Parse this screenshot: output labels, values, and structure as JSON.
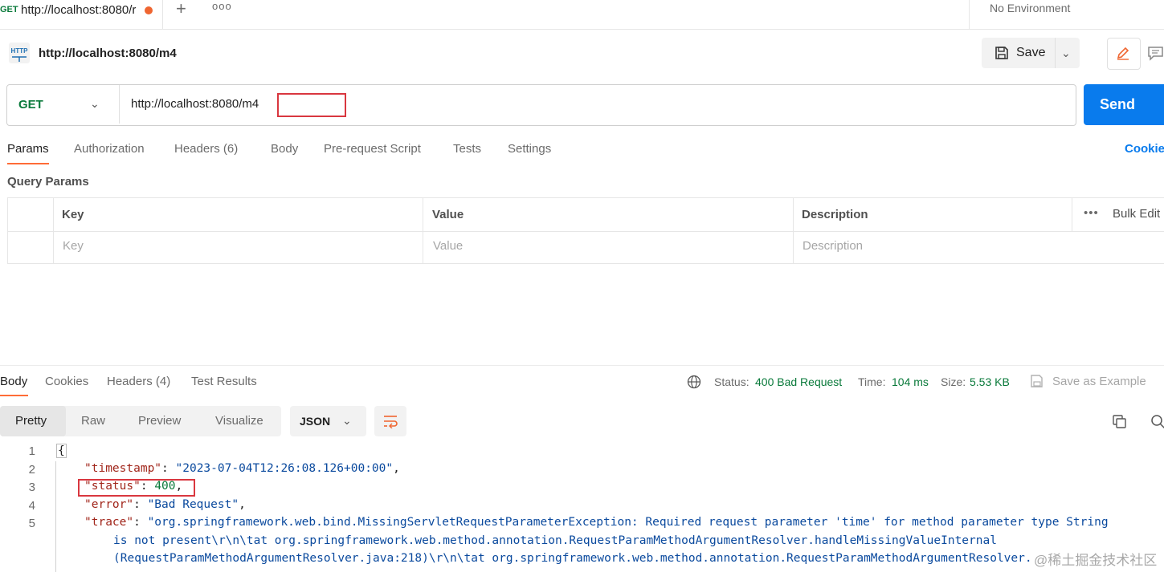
{
  "top_tab": {
    "method": "GET",
    "url": "http://localhost:8080/r",
    "more_icon": "more-horizontal-icon",
    "add_icon": "plus-icon"
  },
  "environment": {
    "label": "No Environment"
  },
  "request": {
    "title": "http://localhost:8080/m4",
    "save_label": "Save",
    "method": "GET",
    "url": "http://localhost:8080/m4",
    "send_label": "Send"
  },
  "request_tabs": [
    {
      "label": "Params"
    },
    {
      "label": "Authorization"
    },
    {
      "label": "Headers (6)"
    },
    {
      "label": "Body"
    },
    {
      "label": "Pre-request Script"
    },
    {
      "label": "Tests"
    },
    {
      "label": "Settings"
    }
  ],
  "cookies_link": "Cookie",
  "query_params": {
    "title": "Query Params",
    "headers": {
      "key": "Key",
      "value": "Value",
      "description": "Description",
      "bulk_edit": "Bulk Edit",
      "more": "•••"
    },
    "placeholders": {
      "key": "Key",
      "value": "Value",
      "description": "Description"
    }
  },
  "response_tabs": [
    {
      "label": "Body"
    },
    {
      "label": "Cookies"
    },
    {
      "label": "Headers (4)"
    },
    {
      "label": "Test Results"
    }
  ],
  "response_meta": {
    "status_label": "Status:",
    "status_value": "400 Bad Request",
    "time_label": "Time:",
    "time_value": "104 ms",
    "size_label": "Size:",
    "size_value": "5.53 KB",
    "save_example": "Save as Example"
  },
  "view_modes": [
    {
      "label": "Pretty"
    },
    {
      "label": "Raw"
    },
    {
      "label": "Preview"
    },
    {
      "label": "Visualize"
    }
  ],
  "format": "JSON",
  "code": {
    "line_numbers": [
      "1",
      "2",
      "3",
      "4",
      "5"
    ],
    "open_brace": "{",
    "timestamp_key": "\"timestamp\"",
    "timestamp_val": "\"2023-07-04T12:26:08.126+00:00\"",
    "status_key": "\"status\"",
    "status_val": "400",
    "error_key": "\"error\"",
    "error_val": "\"Bad Request\"",
    "trace_key": "\"trace\"",
    "trace_line1": "\"org.springframework.web.bind.MissingServletRequestParameterException: Required request parameter 'time' for method parameter type String",
    "trace_line2": "is not present\\r\\n\\tat org.springframework.web.method.annotation.RequestParamMethodArgumentResolver.handleMissingValueInternal",
    "trace_line3": "(RequestParamMethodArgumentResolver.java:218)\\r\\n\\tat org.springframework.web.method.annotation.RequestParamMethodArgumentResolver."
  },
  "watermark": "@稀土掘金技术社区",
  "colors": {
    "accent": "#ff6c37",
    "send": "#097bed",
    "status_ok_text": "#0a7a3b",
    "highlight": "#d9373f"
  }
}
